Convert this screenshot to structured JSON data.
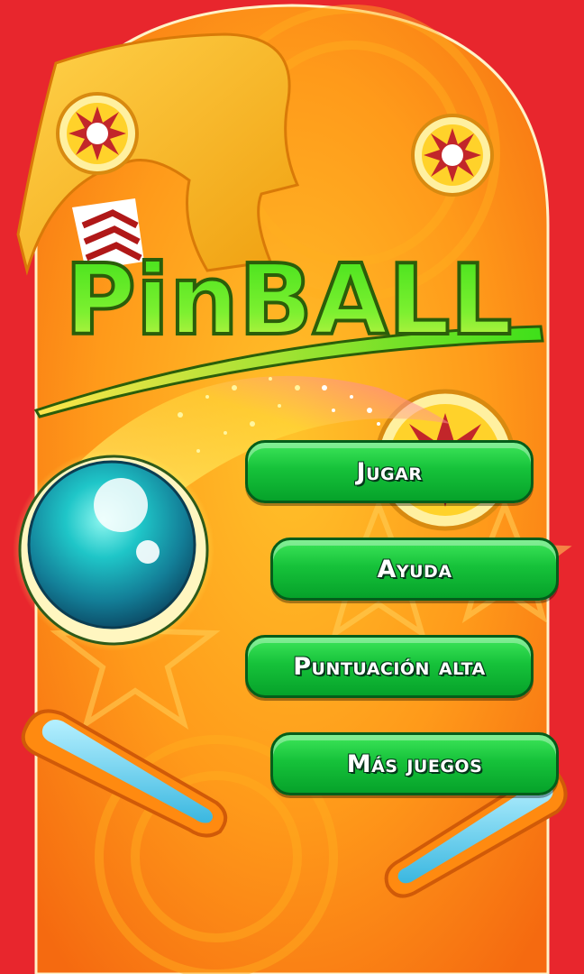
{
  "title": {
    "text": "PinBALL"
  },
  "menu": {
    "items": [
      {
        "label": "Jugar"
      },
      {
        "label": "Ayuda"
      },
      {
        "label": "Puntuación alta"
      },
      {
        "label": "Más juegos"
      }
    ]
  },
  "colors": {
    "table_red": "#e8262d",
    "table_orange": "#ff9a1a",
    "button_green": "#16c23a",
    "title_green": "#3ee01a",
    "ball_teal": "#1aa7b0",
    "flipper_blue": "#6fd6ee"
  },
  "icons": {
    "bumpers": [
      "sun-bumper-icon",
      "sun-bumper-icon",
      "sun-bumper-icon"
    ],
    "ball": "pinball-ball-icon",
    "flippers": [
      "left-flipper-icon",
      "right-flipper-icon"
    ]
  }
}
